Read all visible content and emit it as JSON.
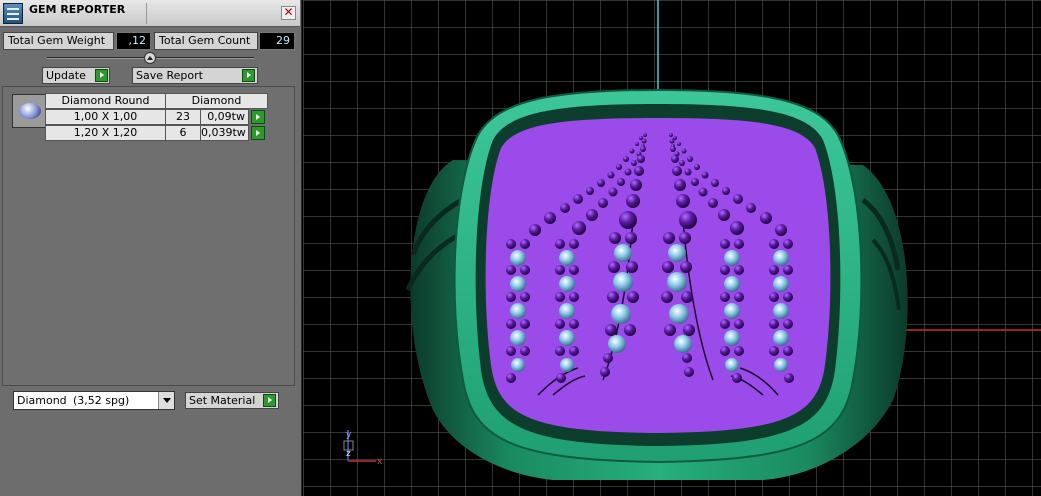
{
  "panel": {
    "title": "GEM REPORTER",
    "close_symbol": "✕",
    "icon": "app-icon",
    "total_gem_weight_label": "Total Gem Weight",
    "total_gem_weight_value": ",12",
    "total_gem_count_label": "Total Gem Count",
    "total_gem_count_value": "29",
    "update_label": "Update",
    "save_report_label": "Save Report"
  },
  "report": {
    "gem_thumbnail_icon": "round-diamond-icon",
    "headers": [
      "Diamond Round",
      "Diamond"
    ],
    "rows": [
      {
        "size": "1,00 X 1,00",
        "count": "23",
        "weight": "0,09tw"
      },
      {
        "size": "1,20 X 1,20",
        "count": "6",
        "weight": "0,039tw"
      }
    ]
  },
  "material": {
    "selected_name": "Diamond",
    "selected_density": "(3,52 spg)",
    "set_material_label": "Set Material"
  },
  "viewport": {
    "axis_labels": {
      "y": "y",
      "z": "z",
      "x": "x"
    },
    "colors": {
      "ring_body": "#1f9f70",
      "ring_face": "#9a4bea",
      "gem_purple": "#5a1aa0",
      "gem_blue": "#8fcbe8",
      "axis_cyan": "#38d0d8",
      "axis_red": "#c83030"
    }
  }
}
